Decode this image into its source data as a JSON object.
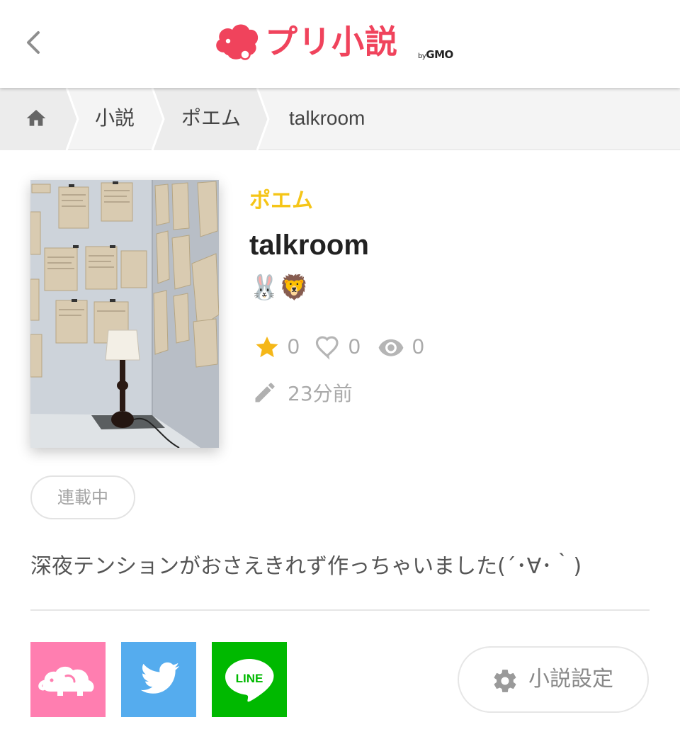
{
  "header": {
    "logo_text": "プリ小説",
    "logo_by": "by",
    "logo_brand": "GMO",
    "brand_color": "#f0435c"
  },
  "breadcrumb": {
    "items": [
      "小説",
      "ポエム",
      "talkroom"
    ]
  },
  "novel": {
    "genre": "ポエム",
    "title": "talkroom",
    "emoji": "🐰🦁",
    "stars": "0",
    "likes": "0",
    "views": "0",
    "updated": "23分前",
    "status": "連載中",
    "description": "深夜テンションがおさえきれず作っちゃいました(´･∀･｀)"
  },
  "share": {
    "items": [
      {
        "icon": "elephant-icon",
        "color": "#ff7eb0"
      },
      {
        "icon": "twitter-icon",
        "color": "#55acee"
      },
      {
        "icon": "line-icon",
        "label": "LINE",
        "color": "#00b900"
      }
    ]
  },
  "settings": {
    "label": "小説設定"
  }
}
